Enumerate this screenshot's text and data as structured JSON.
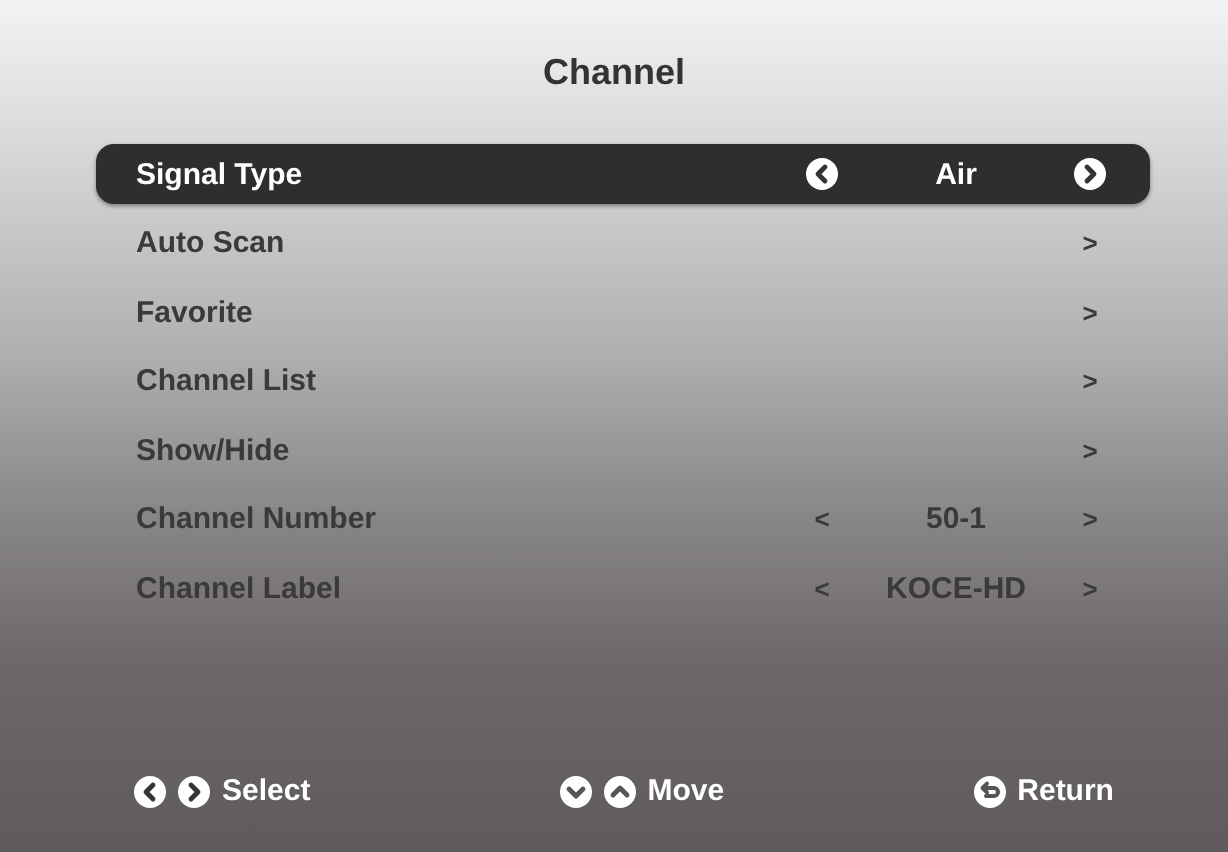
{
  "title": "Channel",
  "rows": [
    {
      "label": "Signal Type",
      "kind": "option",
      "value": "Air",
      "selected": true
    },
    {
      "label": "Auto Scan",
      "kind": "submenu",
      "arrow": ">",
      "selected": false
    },
    {
      "label": "Favorite",
      "kind": "submenu",
      "arrow": ">",
      "selected": false
    },
    {
      "label": "Channel List",
      "kind": "submenu",
      "arrow": ">",
      "selected": false
    },
    {
      "label": "Show/Hide",
      "kind": "submenu",
      "arrow": ">",
      "selected": false
    },
    {
      "label": "Channel Number",
      "kind": "value",
      "prev": "<",
      "value": "50-1",
      "next": ">",
      "selected": false
    },
    {
      "label": "Channel Label",
      "kind": "value",
      "prev": "<",
      "value": "KOCE-HD",
      "next": ">",
      "selected": false
    }
  ],
  "hints": [
    {
      "kind": "left-right",
      "label": "Select"
    },
    {
      "kind": "down-up",
      "label": "Move"
    },
    {
      "kind": "return",
      "label": "Return"
    }
  ]
}
